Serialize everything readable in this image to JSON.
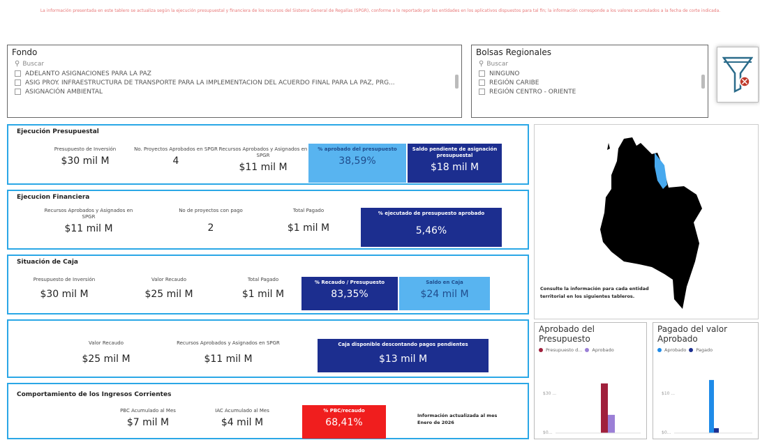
{
  "disclaimer": "La información presentada en este tablero se actualiza según la ejecución presupuestal y financiera de los recursos del Sistema General de Regalías (SPGR), conforme a lo reportado por las entidades en los aplicativos dispuestos para tal fin; la información corresponde a los valores acumulados a la fecha de corte indicada.",
  "fondo": {
    "title": "Fondo",
    "placeholder": "Buscar",
    "items": [
      "ADELANTO ASIGNACIONES PARA LA PAZ",
      "ASIG PROY. INFRAESTRUCTURA DE TRANSPORTE PARA LA IMPLEMENTACION DEL ACUERDO FINAL PARA LA PAZ, PRG...",
      "ASIGNACIÓN AMBIENTAL"
    ]
  },
  "bolsas": {
    "title": "Bolsas Regionales",
    "placeholder": "Buscar",
    "items": [
      "NINGUNO",
      "REGIÓN CARIBE",
      "REGIÓN CENTRO - ORIENTE"
    ]
  },
  "ejecucion_presupuestal": {
    "title": "Ejecución Presupuestal",
    "k1_label": "Presupuesto de Inversión",
    "k1_value": "$30 mil M",
    "k2_label": "No. Proyectos Aprobados en SPGR",
    "k2_value": "4",
    "k3_label": "Recursos Aprobados y Asignados en SPGR",
    "k3_value": "$11 mil M",
    "c1_label": "% aprobado del presupuesto",
    "c1_value": "38,59%",
    "c2_label": "Saldo pendiente de asignación presupuestal",
    "c2_value": "$18 mil M"
  },
  "ejecucion_financiera": {
    "title": "Ejecucion Financiera",
    "k1_label": "Recursos Aprobados y Asignados en SPGR",
    "k1_value": "$11 mil M",
    "k2_label": "No de proyectos con pago",
    "k2_value": "2",
    "k3_label": "Total Pagado",
    "k3_value": "$1 mil M",
    "c1_label": "% ejecutado de presupuesto aprobado",
    "c1_value": "5,46%"
  },
  "situacion_caja": {
    "title": "Situación de Caja",
    "k1_label": "Presupuesto de Inversión",
    "k1_value": "$30 mil M",
    "k2_label": "Valor Recaudo",
    "k2_value": "$25 mil M",
    "k3_label": "Total Pagado",
    "k3_value": "$1 mil M",
    "c1_label": "% Recaudo / Presupuesto",
    "c1_value": "83,35%",
    "c2_label": "Saldo en Caja",
    "c2_value": "$24 mil M"
  },
  "caja_disponible": {
    "k1_label": "Valor Recaudo",
    "k1_value": "$25 mil M",
    "k2_label": "Recursos Aprobados y Asignados en SPGR",
    "k2_value": "$11 mil M",
    "c1_label": "Caja disponible descontando pagos pendientes",
    "c1_value": "$13 mil M"
  },
  "ingresos": {
    "title": "Comportamiento de los Ingresos Corrientes",
    "k1_label": "PBC Acumulado al Mes",
    "k1_value": "$7 mil M",
    "k2_label": "IAC Acumulado al Mes",
    "k2_value": "$4 mil M",
    "c1_label": "% PBC/recaudo",
    "c1_value": "68,41%",
    "note": "Información actualizada al mes Enero de 2026"
  },
  "map": {
    "note": "Consulte la información para cada entidad territorial en los siguientes tableros."
  },
  "chart_aprobado": {
    "title": "Aprobado del Presupuesto",
    "legend": [
      "Presupuesto d...",
      "Aprobado"
    ],
    "ticks": [
      "$30 ...",
      "$0..."
    ]
  },
  "chart_pagado": {
    "title": "Pagado del valor Aprobado",
    "legend": [
      "Aprobado",
      "Pagado"
    ],
    "ticks": [
      "$10 ...",
      "$0..."
    ]
  },
  "colors": {
    "border": "#2aa7e6",
    "dark_card": "#1c2e8f",
    "light_card": "#58b4f0",
    "red_card": "#f01e1e",
    "presupuesto": "#a0203c",
    "aprobado_violet": "#9b7fd6",
    "aprobado_blue": "#1f8be8",
    "pagado": "#1c2e8f"
  },
  "chart_data": [
    {
      "type": "bar",
      "title": "Aprobado del Presupuesto",
      "categories": [
        ""
      ],
      "series": [
        {
          "name": "Presupuesto d...",
          "values": [
            30
          ]
        },
        {
          "name": "Aprobado",
          "values": [
            11
          ]
        }
      ]
    },
    {
      "type": "bar",
      "title": "Pagado del valor Aprobado",
      "categories": [
        ""
      ],
      "series": [
        {
          "name": "Aprobado",
          "values": [
            11
          ]
        },
        {
          "name": "Pagado",
          "values": [
            1
          ]
        }
      ]
    }
  ]
}
